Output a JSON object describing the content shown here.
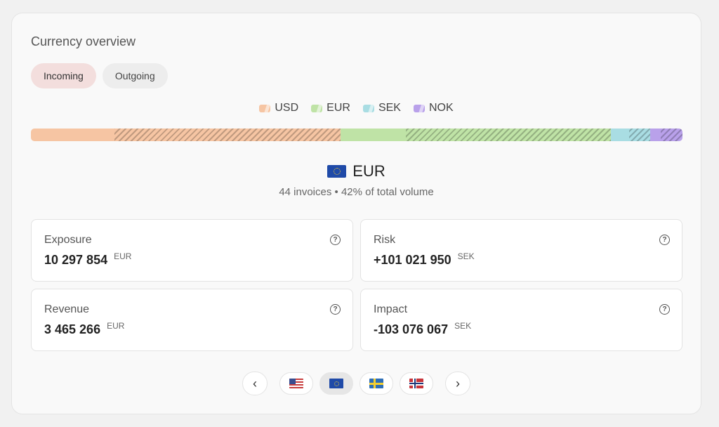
{
  "title": "Currency overview",
  "tabs": [
    {
      "label": "Incoming",
      "active": true
    },
    {
      "label": "Outgoing",
      "active": false
    }
  ],
  "legend": [
    {
      "code": "USD",
      "color": "#f6c5a3"
    },
    {
      "code": "EUR",
      "color": "#bfe3a6"
    },
    {
      "code": "SEK",
      "color": "#a9dde3"
    },
    {
      "code": "NOK",
      "color": "#b9a1ea"
    }
  ],
  "distribution": [
    {
      "code": "USD",
      "color": "#f6c5a3",
      "solid_fraction": 0.128,
      "hatched_fraction": 0.347
    },
    {
      "code": "EUR",
      "color": "#bfe3a6",
      "solid_fraction": 0.1,
      "hatched_fraction": 0.315
    },
    {
      "code": "SEK",
      "color": "#a9dde3",
      "solid_fraction": 0.028,
      "hatched_fraction": 0.032
    },
    {
      "code": "NOK",
      "color": "#b9a1ea",
      "solid_fraction": 0.017,
      "hatched_fraction": 0.033
    }
  ],
  "selected": {
    "code": "EUR",
    "flag_icon": "eu-flag-icon",
    "subtitle": "44 invoices • 42% of total volume"
  },
  "metrics": [
    {
      "label": "Exposure",
      "value": "10 297 854",
      "unit": "EUR"
    },
    {
      "label": "Risk",
      "value": "+101 021 950",
      "unit": "SEK"
    },
    {
      "label": "Revenue",
      "value": "3 465 266",
      "unit": "EUR"
    },
    {
      "label": "Impact",
      "value": "-103 076 067",
      "unit": "SEK"
    }
  ],
  "pager": {
    "prev_icon": "chevron-left-icon",
    "next_icon": "chevron-right-icon",
    "prev_glyph": "‹",
    "next_glyph": "›",
    "help_glyph": "?",
    "flags": [
      {
        "code": "USD",
        "icon": "us-flag-icon",
        "active": false
      },
      {
        "code": "EUR",
        "icon": "eu-flag-icon",
        "active": true
      },
      {
        "code": "SEK",
        "icon": "sweden-flag-icon",
        "active": false
      },
      {
        "code": "NOK",
        "icon": "norway-flag-icon",
        "active": false
      }
    ]
  }
}
